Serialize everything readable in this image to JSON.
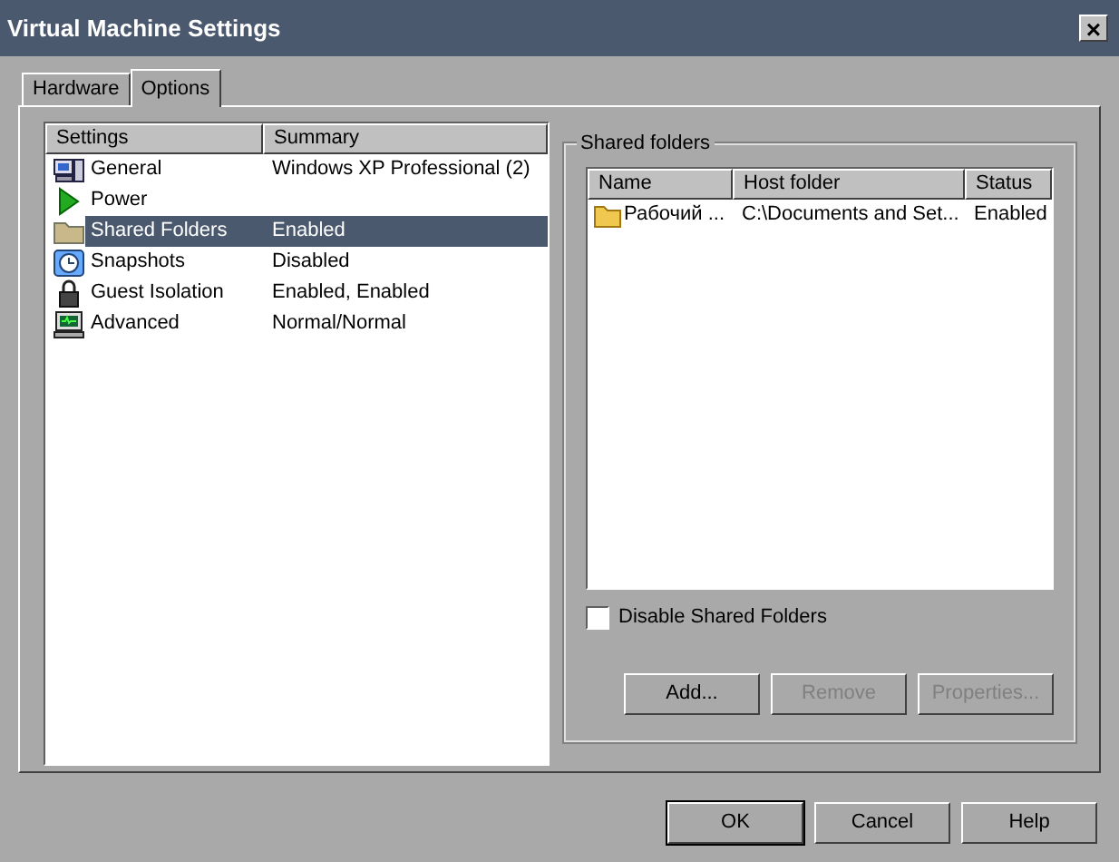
{
  "window": {
    "title": "Virtual Machine Settings",
    "close": "×"
  },
  "tabs": [
    {
      "label": "Hardware",
      "selected": false
    },
    {
      "label": "Options",
      "selected": true
    }
  ],
  "settings": {
    "columns": [
      "Settings",
      "Summary"
    ],
    "rows": [
      {
        "name": "General",
        "summary": "Windows XP Professional (2)",
        "selected": false
      },
      {
        "name": "Power",
        "summary": "",
        "selected": false
      },
      {
        "name": "Shared Folders",
        "summary": "Enabled",
        "selected": true
      },
      {
        "name": "Snapshots",
        "summary": "Disabled",
        "selected": false
      },
      {
        "name": "Guest Isolation",
        "summary": "Enabled, Enabled",
        "selected": false
      },
      {
        "name": "Advanced",
        "summary": "Normal/Normal",
        "selected": false
      }
    ]
  },
  "shared_folders": {
    "title": "Shared folders",
    "columns": [
      "Name",
      "Host folder",
      "Status"
    ],
    "rows": [
      {
        "name": "Рабочий ...",
        "host_folder": "C:\\Documents and Set...",
        "status": "Enabled"
      }
    ],
    "disable_checkbox": {
      "label": "Disable Shared Folders",
      "checked": false
    },
    "buttons": [
      {
        "label": "Add...",
        "disabled": false
      },
      {
        "label": "Remove",
        "disabled": true
      },
      {
        "label": "Properties...",
        "disabled": true
      }
    ]
  },
  "buttons": [
    {
      "label": "OK",
      "default": true
    },
    {
      "label": "Cancel",
      "default": false
    },
    {
      "label": "Help",
      "default": false
    }
  ]
}
